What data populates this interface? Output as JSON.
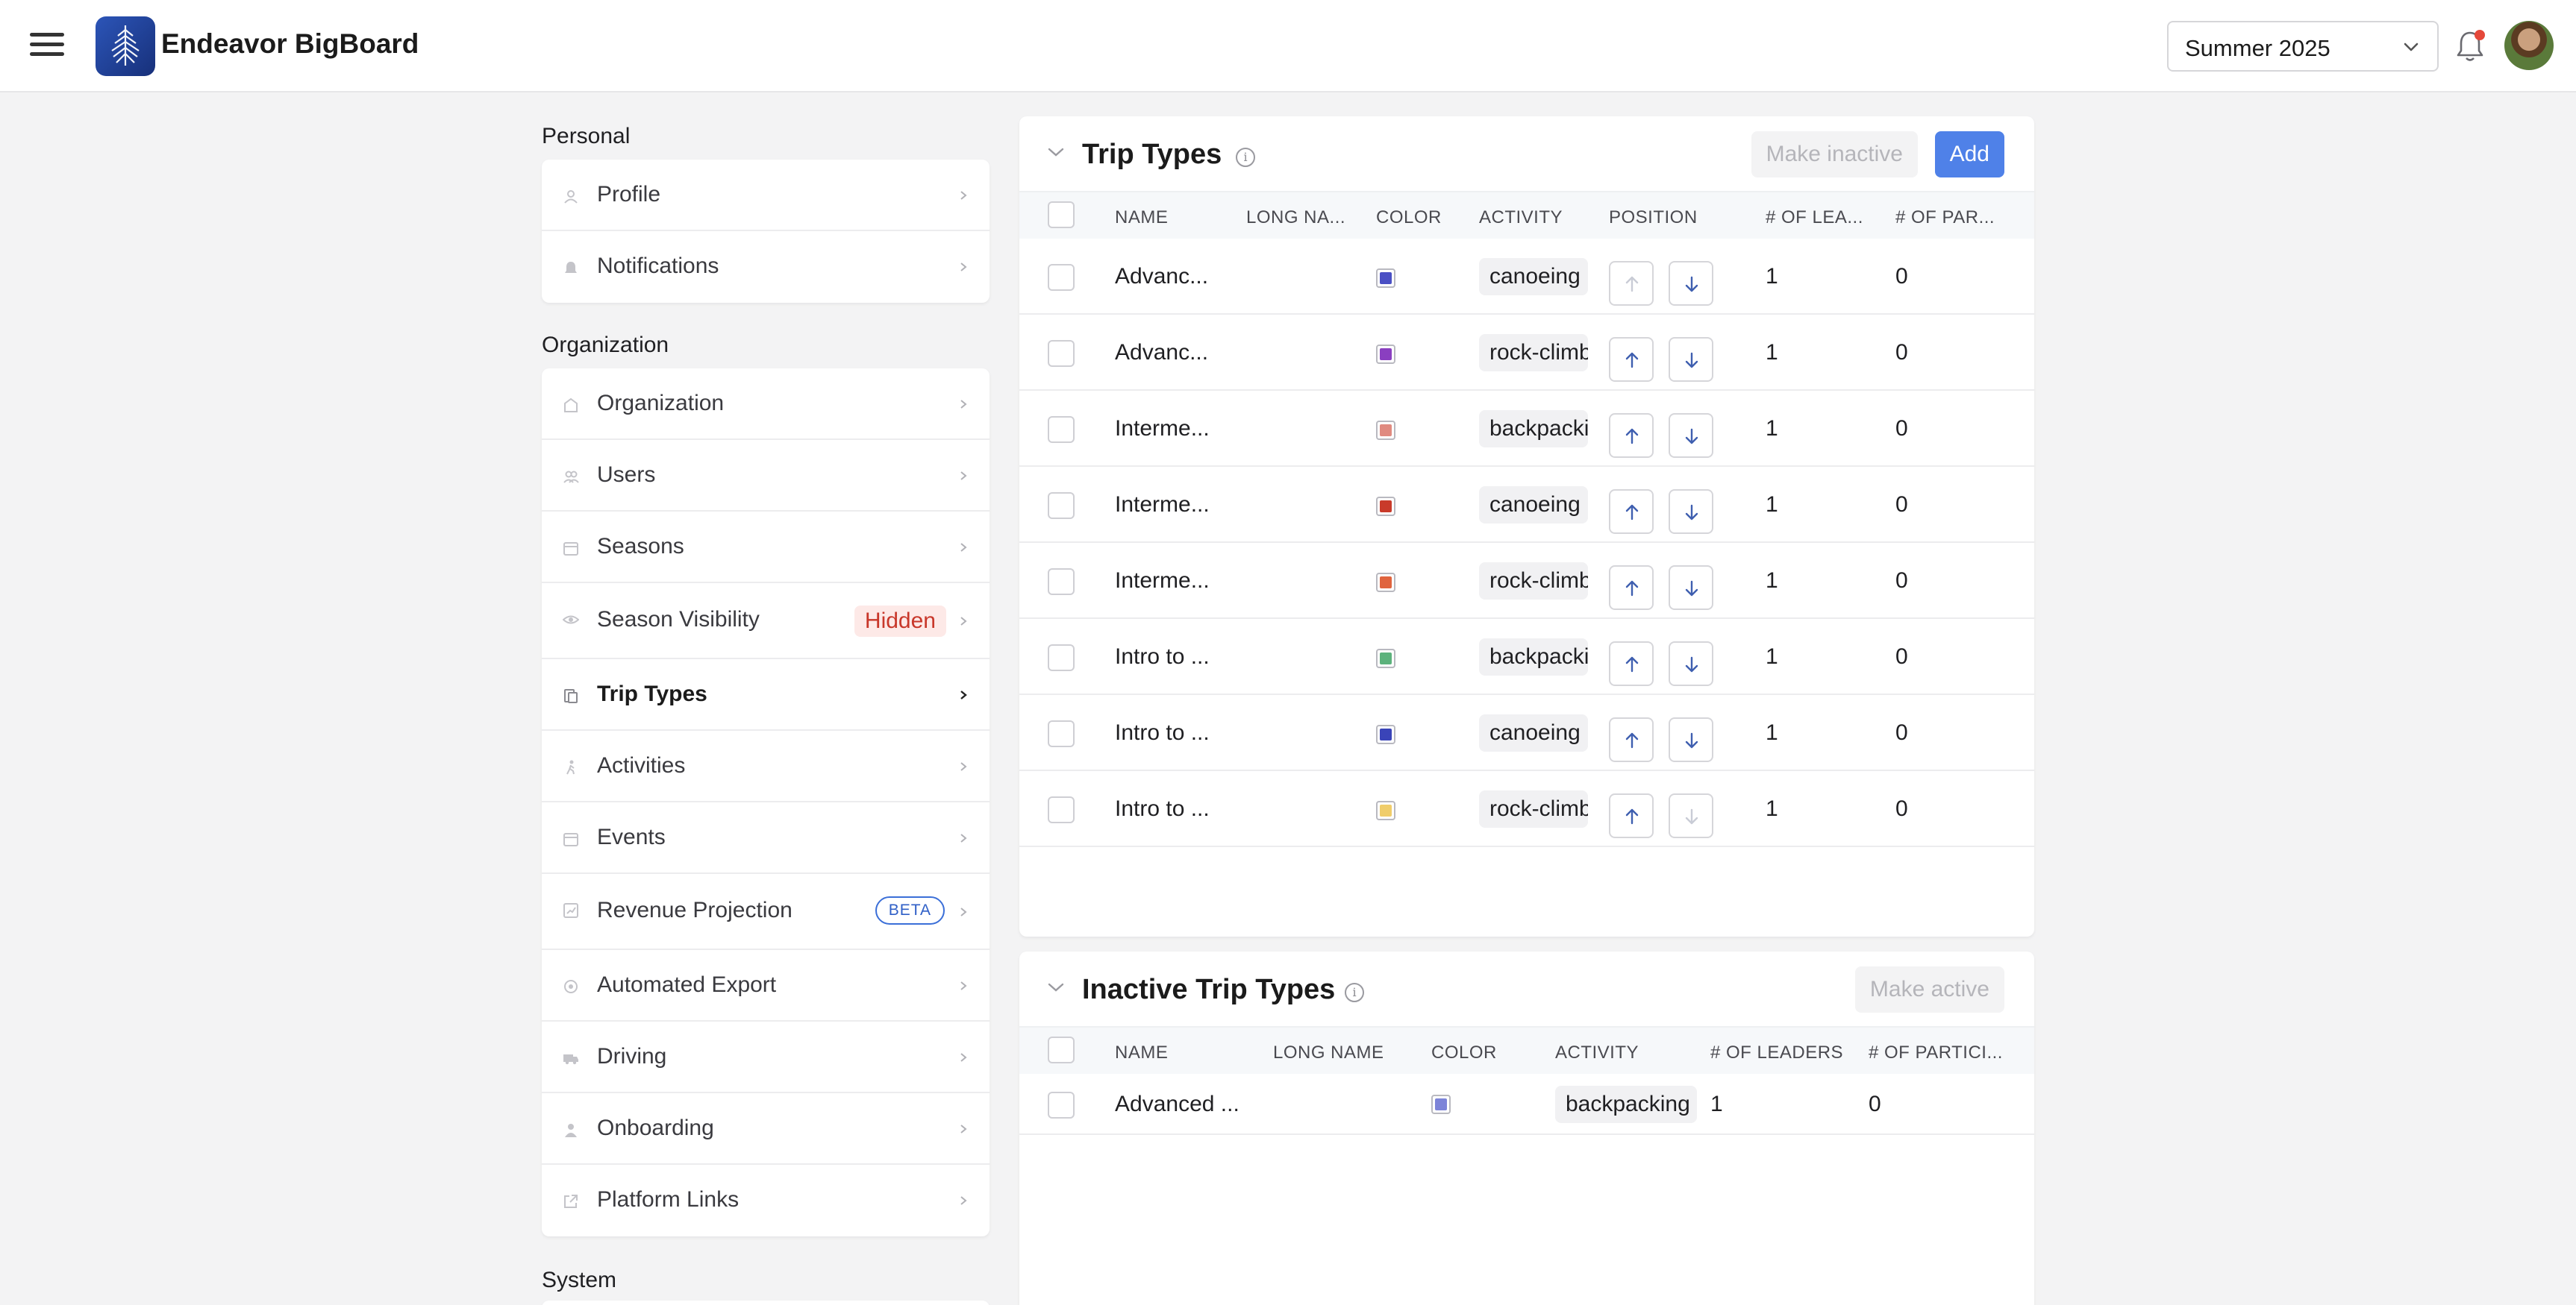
{
  "app": {
    "title": "Endeavor BigBoard"
  },
  "header": {
    "season": "Summer 2025",
    "icons": {
      "menu": "hamburger-icon",
      "notifications": "bell-icon",
      "notification_dot_color": "#e5483a"
    }
  },
  "sidebar": {
    "sections": [
      {
        "label": "Personal",
        "items": [
          {
            "label": "Profile",
            "icon": "user-icon"
          },
          {
            "label": "Notifications",
            "icon": "bell-icon"
          }
        ]
      },
      {
        "label": "Organization",
        "items": [
          {
            "label": "Organization",
            "icon": "building-icon"
          },
          {
            "label": "Users",
            "icon": "users-icon"
          },
          {
            "label": "Seasons",
            "icon": "calendar-icon"
          },
          {
            "label": "Season Visibility",
            "icon": "eye-icon",
            "badge": "Hidden"
          },
          {
            "label": "Trip Types",
            "icon": "trip-types-icon",
            "active": true
          },
          {
            "label": "Activities",
            "icon": "hiker-icon"
          },
          {
            "label": "Events",
            "icon": "calendar-icon"
          },
          {
            "label": "Revenue Projection",
            "icon": "chart-icon",
            "badge": "BETA"
          },
          {
            "label": "Automated Export",
            "icon": "export-icon"
          },
          {
            "label": "Driving",
            "icon": "van-icon"
          },
          {
            "label": "Onboarding",
            "icon": "person-icon"
          },
          {
            "label": "Platform Links",
            "icon": "external-link-icon"
          }
        ]
      },
      {
        "label": "System",
        "items": []
      }
    ]
  },
  "trip_types": {
    "title": "Trip Types",
    "make_inactive_label": "Make inactive",
    "add_label": "Add",
    "columns": [
      "NAME",
      "LONG NA...",
      "COLOR",
      "ACTIVITY",
      "POSITION",
      "# OF LEA...",
      "# OF PAR..."
    ],
    "rows": [
      {
        "name": "Advanc...",
        "long_name": "",
        "color": "#4a4fc4",
        "activity": "canoeing",
        "leaders": "1",
        "participants": "0",
        "up_disabled": true,
        "down_disabled": false
      },
      {
        "name": "Advanc...",
        "long_name": "",
        "color": "#8a3fc0",
        "activity": "rock-climbing",
        "leaders": "1",
        "participants": "0",
        "up_disabled": false,
        "down_disabled": false
      },
      {
        "name": "Interme...",
        "long_name": "",
        "color": "#e08a80",
        "activity": "backpacking",
        "leaders": "1",
        "participants": "0",
        "up_disabled": false,
        "down_disabled": false
      },
      {
        "name": "Interme...",
        "long_name": "",
        "color": "#c93a2a",
        "activity": "canoeing",
        "leaders": "1",
        "participants": "0",
        "up_disabled": false,
        "down_disabled": false
      },
      {
        "name": "Interme...",
        "long_name": "",
        "color": "#e0643e",
        "activity": "rock-climbing",
        "leaders": "1",
        "participants": "0",
        "up_disabled": false,
        "down_disabled": false
      },
      {
        "name": "Intro to ...",
        "long_name": "",
        "color": "#5cb27c",
        "activity": "backpacking",
        "leaders": "1",
        "participants": "0",
        "up_disabled": false,
        "down_disabled": false
      },
      {
        "name": "Intro to ...",
        "long_name": "",
        "color": "#3a44b8",
        "activity": "canoeing",
        "leaders": "1",
        "participants": "0",
        "up_disabled": false,
        "down_disabled": false
      },
      {
        "name": "Intro to ...",
        "long_name": "",
        "color": "#f0cd6a",
        "activity": "rock-climbing",
        "leaders": "1",
        "participants": "0",
        "up_disabled": false,
        "down_disabled": true
      }
    ]
  },
  "inactive_trip_types": {
    "title": "Inactive Trip Types",
    "make_active_label": "Make active",
    "columns": [
      "NAME",
      "LONG NAME",
      "COLOR",
      "ACTIVITY",
      "# OF LEADERS",
      "# OF PARTICI..."
    ],
    "rows": [
      {
        "name": "Advanced ...",
        "long_name": "",
        "color": "#7d84d8",
        "activity": "backpacking",
        "leaders": "1",
        "participants": "0"
      }
    ]
  }
}
